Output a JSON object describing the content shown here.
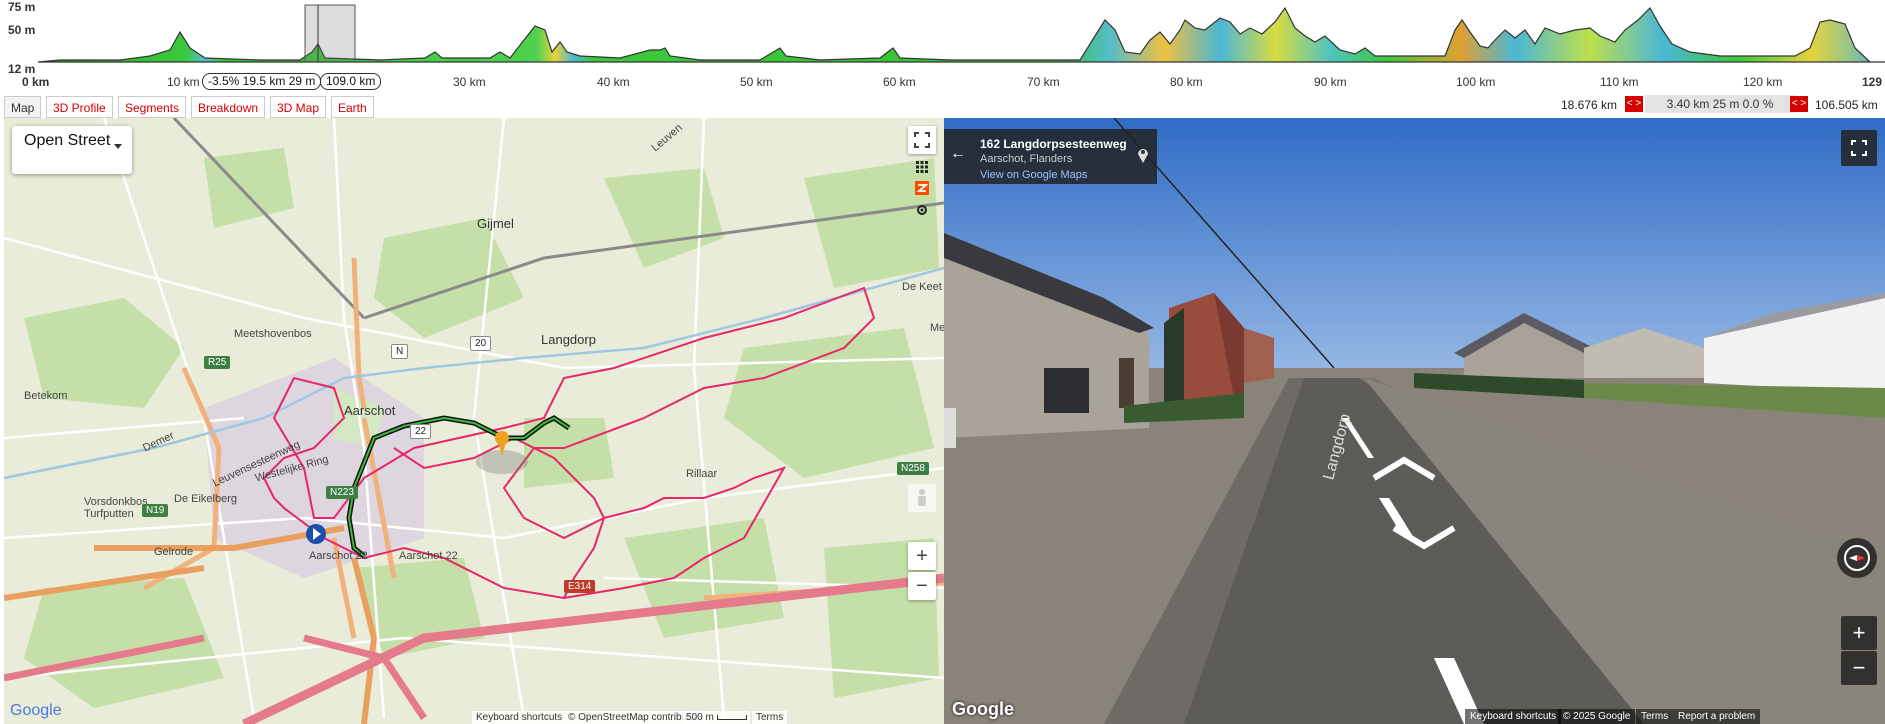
{
  "profile": {
    "y_labels": [
      "75 m",
      "50 m",
      "12 m"
    ],
    "x_labels": [
      "0 km",
      "10 km",
      "30 km",
      "40 km",
      "50 km",
      "60 km",
      "70 km",
      "80 km",
      "90 km",
      "100 km",
      "110 km",
      "120 km",
      "129"
    ],
    "hover_stats": "-3.5% 19.5 km 29 m",
    "hover_distance": "109.0 km"
  },
  "tabs": [
    "Map",
    "3D Profile",
    "Segments",
    "Breakdown",
    "3D Map",
    "Earth"
  ],
  "active_tab": "Map",
  "range": {
    "start": "18.676 km",
    "segment": "3.40 km 25 m 0.0 %",
    "end": "106.505 km",
    "button": "< >"
  },
  "map": {
    "layer_select": "Open Street",
    "places": [
      "Gijmel",
      "Langdorp",
      "Aarschot",
      "Betekom",
      "Rillaar",
      "Meetshovenbos",
      "Vorsdonkbos Turfputten",
      "De Eikelberg",
      "Gelrode",
      "De Keet",
      "Me",
      "Leuven",
      "Westelijke Ring",
      "Leuvensesteenweg",
      "Demer",
      "Aarschot 22",
      "Aarschot 22"
    ],
    "roads": [
      "R25",
      "N19",
      "N223",
      "N258",
      "E314",
      "20",
      "22",
      "N"
    ],
    "attribution_keys": "Keyboard shortcuts",
    "attribution_osm": "© OpenStreetMap contributors",
    "scale": "500 m",
    "terms": "Terms",
    "google": "Google",
    "zoom_in": "+",
    "zoom_out": "−"
  },
  "streetview": {
    "address": "162 Langdorpsesteenweg",
    "city": "Aarschot, Flanders",
    "link": "View on Google Maps",
    "back": "←",
    "road_text": "Langdorp",
    "keyboard": "Keyboard shortcuts",
    "copyright": "© 2025 Google",
    "terms": "Terms",
    "report": "Report a problem",
    "google": "Google",
    "zoom_in": "+",
    "zoom_out": "−"
  }
}
